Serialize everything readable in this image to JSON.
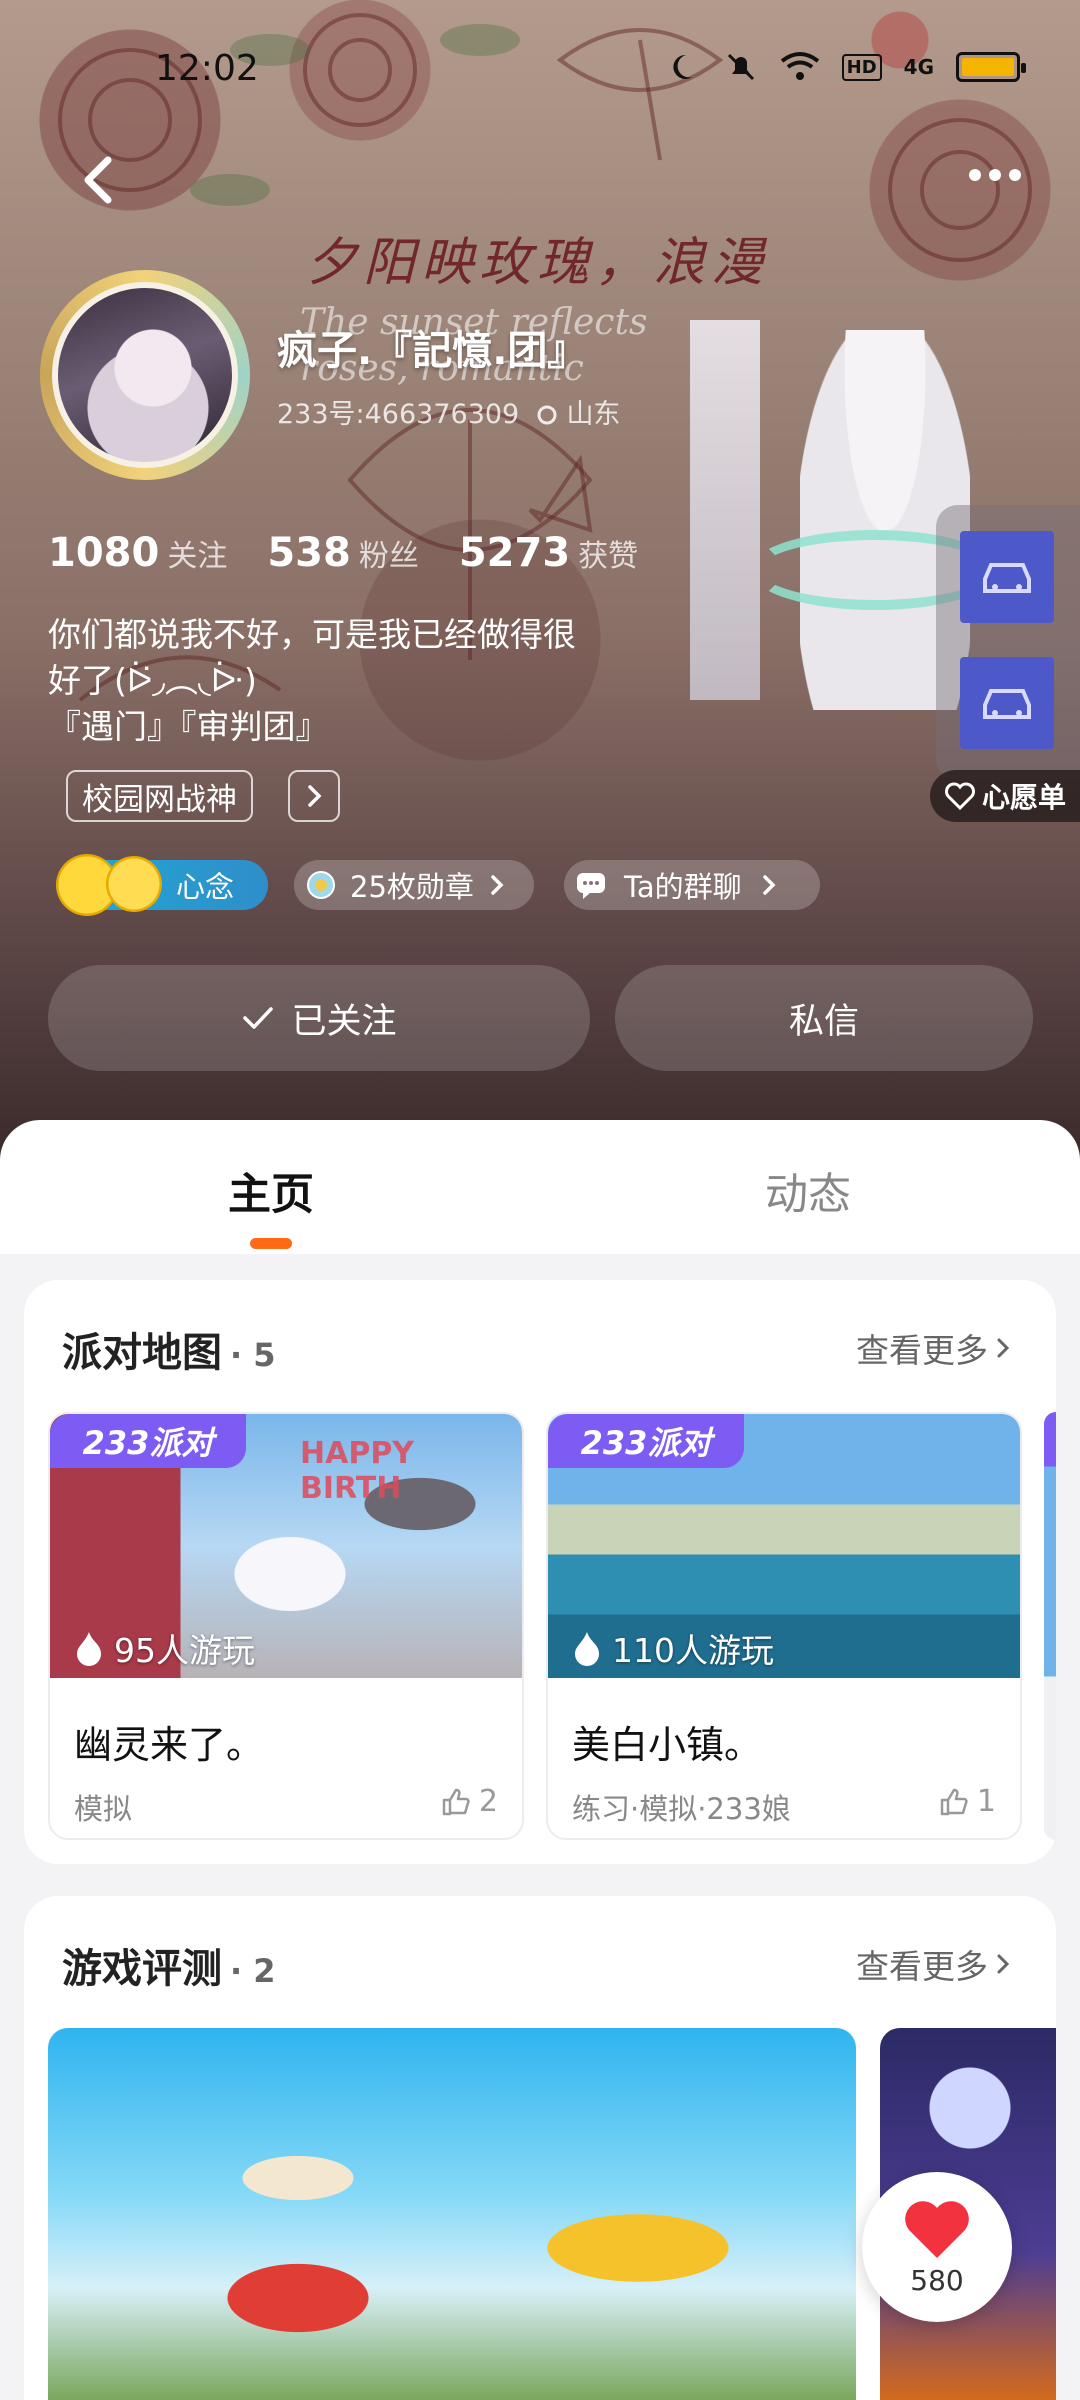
{
  "status": {
    "time": "12:02",
    "network": "4G",
    "hd": "HD"
  },
  "header": {
    "banner_text": "夕阳映玫瑰，浪漫",
    "banner_text_en": "The sunset reflects roses, romantic"
  },
  "profile": {
    "username": "疯子.『記憶.团』",
    "id_line": "233号:466376309",
    "location": "山东",
    "stats": [
      {
        "num": "1080",
        "label": "关注"
      },
      {
        "num": "538",
        "label": "粉丝"
      },
      {
        "num": "5273",
        "label": "获赞"
      }
    ],
    "bio_line1": "你们都说我不好，可是我已经做得很",
    "bio_line2": "好了(ᐖ◞︵◟ᐕ)",
    "bio_line3": "『遇门』『审判团』",
    "tag": "校园网战神",
    "mood_label": "心念",
    "medals_label": "25枚勋章",
    "group_label": "Ta的群聊",
    "follow_label": "已关注",
    "message_label": "私信",
    "wishlist_label": "心愿单"
  },
  "tabs": [
    {
      "label": "主页"
    },
    {
      "label": "动态"
    }
  ],
  "party_section": {
    "title": "派对地图",
    "count": "· 5",
    "more": "查看更多",
    "badge": "233派对",
    "cards": [
      {
        "plays": "95人游玩",
        "name": "幽灵来了。",
        "tags": "模拟",
        "likes": "2",
        "banner_text": "HAPPY BIRTH"
      },
      {
        "plays": "110人游玩",
        "name": "美白小镇。",
        "tags": "练习·模拟·233娘",
        "likes": "1"
      }
    ]
  },
  "review_section": {
    "title": "游戏评测",
    "count": "· 2",
    "more": "查看更多"
  },
  "like_fab": {
    "count": "580"
  },
  "colors": {
    "accent": "#ff6a14",
    "party_badge": "#7d5cf3",
    "car_button": "#4d58c9",
    "like_heart": "#f2323f"
  }
}
